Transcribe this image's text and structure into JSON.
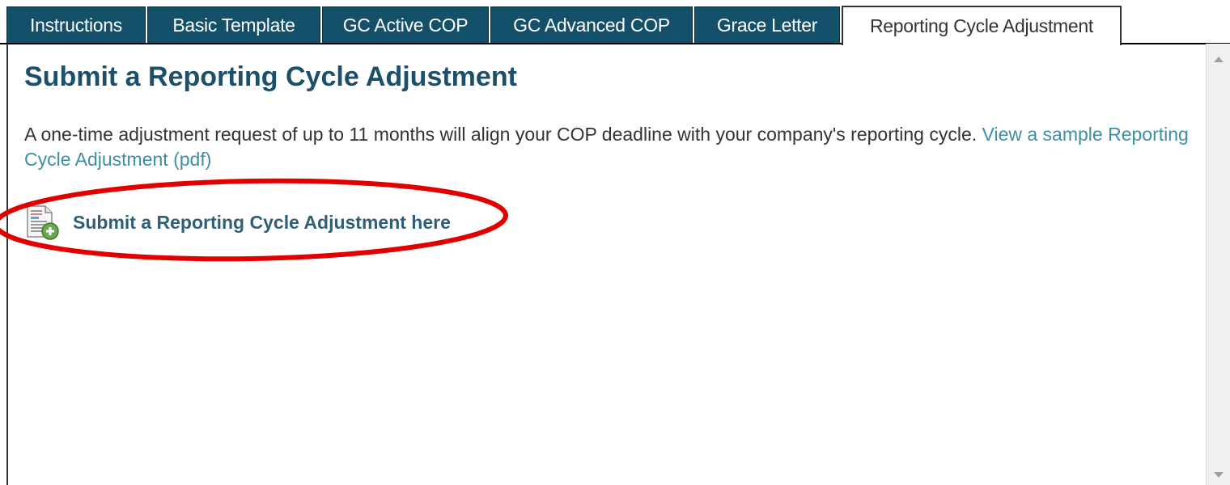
{
  "tabs": [
    {
      "label": "Instructions",
      "active": false
    },
    {
      "label": "Basic Template",
      "active": false
    },
    {
      "label": "GC Active COP",
      "active": false
    },
    {
      "label": "GC Advanced COP",
      "active": false
    },
    {
      "label": "Grace Letter",
      "active": false
    },
    {
      "label": "Reporting Cycle Adjustment",
      "active": true
    }
  ],
  "main": {
    "title": "Submit a Reporting Cycle Adjustment",
    "description": "A one-time adjustment request of up to 11 months will align your COP deadline with your company's reporting cycle.",
    "sample_link": "View a sample Reporting Cycle Adjustment (pdf)",
    "action_link": "Submit a Reporting Cycle Adjustment here",
    "action_icon": "document-add-icon"
  },
  "colors": {
    "tab_bg": "#15506b",
    "title": "#1b4f6a",
    "link": "#3c8fa6",
    "annotation": "#e00000"
  }
}
